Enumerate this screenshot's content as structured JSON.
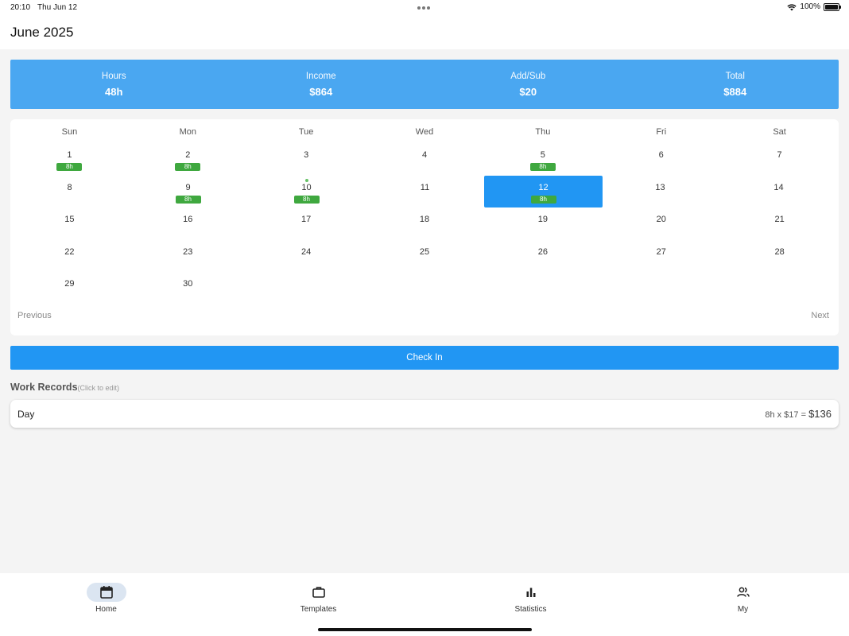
{
  "status": {
    "time": "20:10",
    "date": "Thu Jun 12",
    "battery": "100%"
  },
  "header": {
    "title": "June 2025"
  },
  "summary": [
    {
      "label": "Hours",
      "value": "48h"
    },
    {
      "label": "Income",
      "value": "$864"
    },
    {
      "label": "Add/Sub",
      "value": "$20"
    },
    {
      "label": "Total",
      "value": "$884"
    }
  ],
  "calendar": {
    "weekdays": [
      "Sun",
      "Mon",
      "Tue",
      "Wed",
      "Thu",
      "Fri",
      "Sat"
    ],
    "weeks": [
      [
        {
          "d": "1",
          "tag": "8h"
        },
        {
          "d": "2",
          "tag": "8h"
        },
        {
          "d": "3"
        },
        {
          "d": "4"
        },
        {
          "d": "5",
          "tag": "8h"
        },
        {
          "d": "6"
        },
        {
          "d": "7"
        }
      ],
      [
        {
          "d": "8"
        },
        {
          "d": "9",
          "tag": "8h"
        },
        {
          "d": "10",
          "tag": "8h",
          "dot": true
        },
        {
          "d": "11"
        },
        {
          "d": "12",
          "tag": "8h",
          "selected": true
        },
        {
          "d": "13"
        },
        {
          "d": "14"
        }
      ],
      [
        {
          "d": "15"
        },
        {
          "d": "16"
        },
        {
          "d": "17"
        },
        {
          "d": "18"
        },
        {
          "d": "19"
        },
        {
          "d": "20"
        },
        {
          "d": "21"
        }
      ],
      [
        {
          "d": "22"
        },
        {
          "d": "23"
        },
        {
          "d": "24"
        },
        {
          "d": "25"
        },
        {
          "d": "26"
        },
        {
          "d": "27"
        },
        {
          "d": "28"
        }
      ],
      [
        {
          "d": "29"
        },
        {
          "d": "30"
        },
        {
          "d": ""
        },
        {
          "d": ""
        },
        {
          "d": ""
        },
        {
          "d": ""
        },
        {
          "d": ""
        }
      ]
    ],
    "prev_label": "Previous",
    "next_label": "Next"
  },
  "checkin_label": "Check In",
  "records": {
    "title": "Work Records",
    "hint": "(Click to edit)",
    "items": [
      {
        "name": "Day",
        "calc": "8h x $17 = ",
        "amount": "$136"
      }
    ]
  },
  "nav": [
    {
      "label": "Home",
      "icon": "calendar-icon",
      "active": true
    },
    {
      "label": "Templates",
      "icon": "briefcase-icon"
    },
    {
      "label": "Statistics",
      "icon": "bar-chart-icon"
    },
    {
      "label": "My",
      "icon": "people-icon"
    }
  ],
  "colors": {
    "summary_bg": "#4aa7f1",
    "primary": "#2196f3",
    "tag_green": "#3fa83f",
    "nav_active_bg": "#dbe5f1"
  }
}
